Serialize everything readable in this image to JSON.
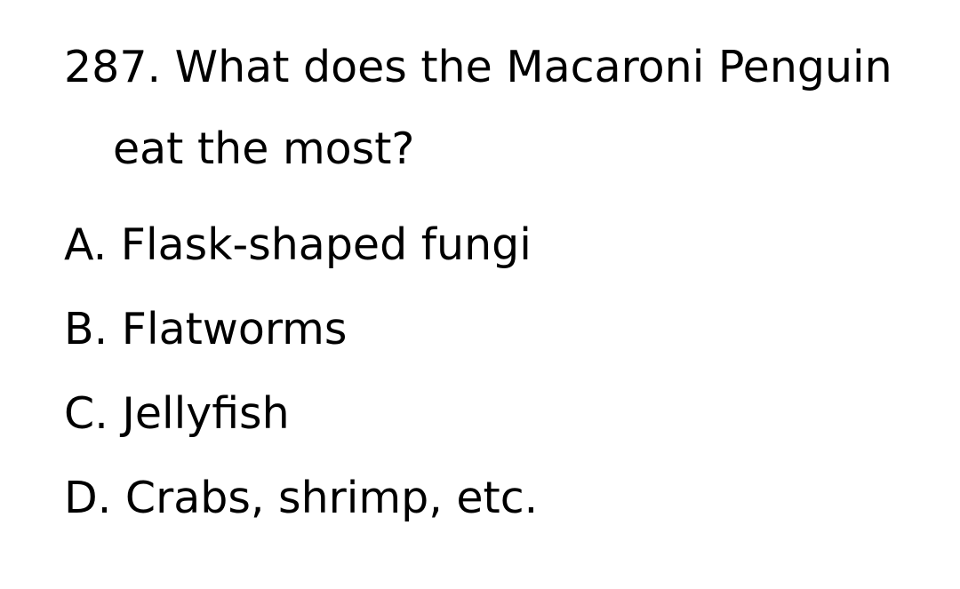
{
  "question": {
    "number_and_text_line1": "287. What does the Macaroni Penguin",
    "text_line2": "eat the most?"
  },
  "options": [
    {
      "label": "A. Flask-shaped fungi"
    },
    {
      "label": "B. Flatworms"
    },
    {
      "label": "C. Jellyfish"
    },
    {
      "label": "D. Crabs, shrimp, etc."
    }
  ]
}
